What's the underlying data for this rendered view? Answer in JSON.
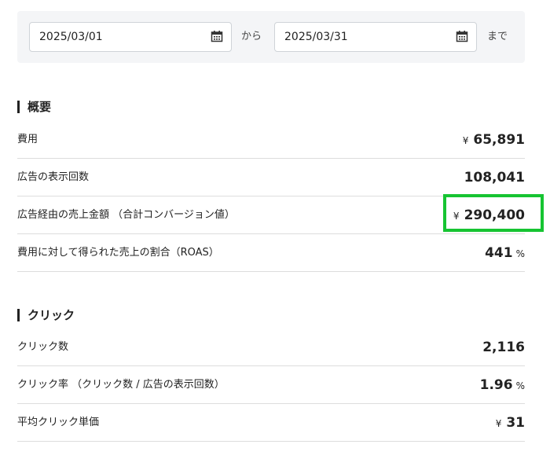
{
  "date_range": {
    "start": "2025/03/01",
    "from_label": "から",
    "end": "2025/03/31",
    "to_label": "まで"
  },
  "overview": {
    "title": "概要",
    "rows": [
      {
        "label": "費用",
        "prefix": "¥",
        "value": "65,891",
        "unit": ""
      },
      {
        "label": "広告の表示回数",
        "prefix": "",
        "value": "108,041",
        "unit": ""
      },
      {
        "label": "広告経由の売上金額 （合計コンバージョン値）",
        "prefix": "¥",
        "value": "290,400",
        "unit": ""
      },
      {
        "label": "費用に対して得られた売上の割合（ROAS）",
        "prefix": "",
        "value": "441",
        "unit": "%"
      }
    ]
  },
  "clicks": {
    "title": "クリック",
    "rows": [
      {
        "label": "クリック数",
        "prefix": "",
        "value": "2,116",
        "unit": ""
      },
      {
        "label": "クリック率 （クリック数 / 広告の表示回数）",
        "prefix": "",
        "value": "1.96",
        "unit": "%"
      },
      {
        "label": "平均クリック単価",
        "prefix": "¥",
        "value": "31",
        "unit": ""
      }
    ]
  },
  "colors": {
    "highlight": "#16c432",
    "panel_bg": "#f4f5f7"
  },
  "icons": [
    "calendar-icon"
  ]
}
